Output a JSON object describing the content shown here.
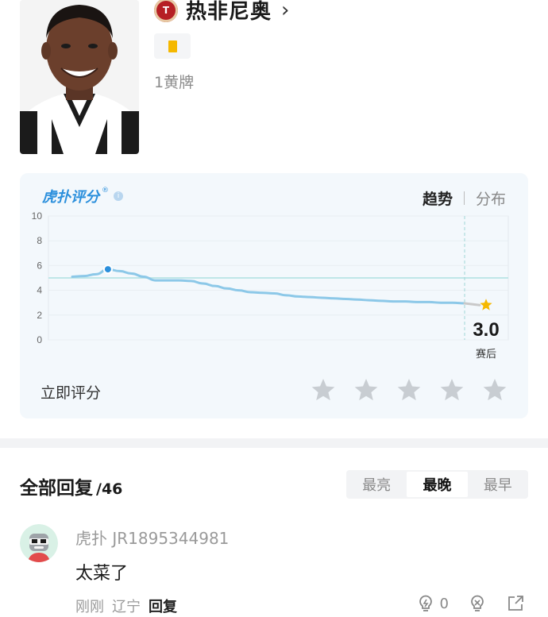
{
  "player": {
    "team_name": "热非尼奥",
    "team_logo_text": "T",
    "chevron": "›",
    "card_summary": "1黄牌"
  },
  "rating": {
    "brand": "虎扑评分",
    "brand_reg": "®",
    "info": "i",
    "switch_active": "趋势",
    "switch_inactive": "分布",
    "rate_now": "立即评分",
    "star_count": 5
  },
  "chart_data": {
    "type": "line",
    "ylim": [
      0,
      10
    ],
    "yticks": [
      "10",
      "8",
      "6",
      "4",
      "2",
      "0"
    ],
    "reference_line": 5,
    "highlight_index": 3,
    "values": [
      5.1,
      5.15,
      5.3,
      5.7,
      5.55,
      5.35,
      5.1,
      4.8,
      4.8,
      4.8,
      4.75,
      4.55,
      4.35,
      4.15,
      4.0,
      3.85,
      3.8,
      3.75,
      3.6,
      3.5,
      3.45,
      3.4,
      3.35,
      3.3,
      3.25,
      3.2,
      3.15,
      3.1,
      3.1,
      3.05,
      3.05,
      3.0,
      3.0,
      2.95
    ],
    "final_score": "3.0",
    "final_label": "赛后",
    "colors": {
      "line": "#8cc8e8",
      "ref": "#bfe6e8",
      "marker": "#2b8fdc",
      "star": "#f5b800"
    }
  },
  "replies": {
    "title": "全部回复",
    "count": "/46",
    "sort": [
      "最亮",
      "最晚",
      "最早"
    ],
    "sort_active": 1
  },
  "comment": {
    "user": "虎扑 JR1895344981",
    "text": "太菜了",
    "time": "刚刚",
    "location": "辽宁",
    "reply": "回复",
    "likes": "0"
  }
}
